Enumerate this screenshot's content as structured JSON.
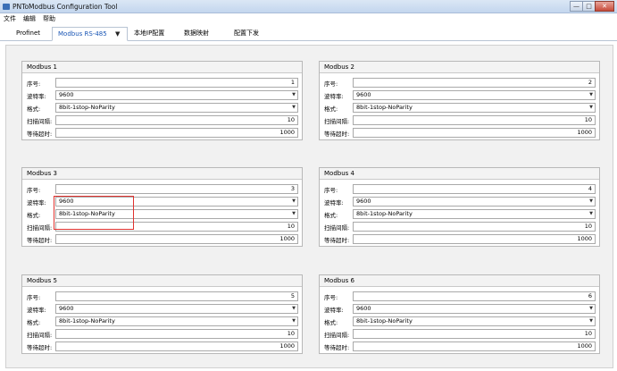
{
  "window": {
    "title": "PNToModbus Configuration Tool",
    "minimize": "—",
    "maximize": "□",
    "close": "✕"
  },
  "menu": [
    {
      "label": "文件"
    },
    {
      "label": "编辑"
    },
    {
      "label": "帮助"
    }
  ],
  "tabs": [
    {
      "label": "Profinet"
    },
    {
      "label": "Modbus RS-485",
      "caret": "▼"
    },
    {
      "label": "本地IP配置"
    },
    {
      "label": "数据映射"
    },
    {
      "label": "配置下发"
    }
  ],
  "labels": {
    "index": "序号:",
    "baud": "波特率:",
    "format": "格式:",
    "scan": "扫描间隔:",
    "timeout": "等待超时:"
  },
  "caret": "▼",
  "groups": [
    {
      "title": "Modbus 1",
      "index": "1",
      "baud": "9600",
      "format": "8bit-1stop-NoParity",
      "scan": "10",
      "timeout": "1000"
    },
    {
      "title": "Modbus 2",
      "index": "2",
      "baud": "9600",
      "format": "8bit-1stop-NoParity",
      "scan": "10",
      "timeout": "1000"
    },
    {
      "title": "Modbus 3",
      "index": "3",
      "baud": "9600",
      "format": "8bit-1stop-NoParity",
      "scan": "10",
      "timeout": "1000"
    },
    {
      "title": "Modbus 4",
      "index": "4",
      "baud": "9600",
      "format": "8bit-1stop-NoParity",
      "scan": "10",
      "timeout": "1000"
    },
    {
      "title": "Modbus 5",
      "index": "5",
      "baud": "9600",
      "format": "8bit-1stop-NoParity",
      "scan": "10",
      "timeout": "1000"
    },
    {
      "title": "Modbus 6",
      "index": "6",
      "baud": "9600",
      "format": "8bit-1stop-NoParity",
      "scan": "10",
      "timeout": "1000"
    }
  ]
}
